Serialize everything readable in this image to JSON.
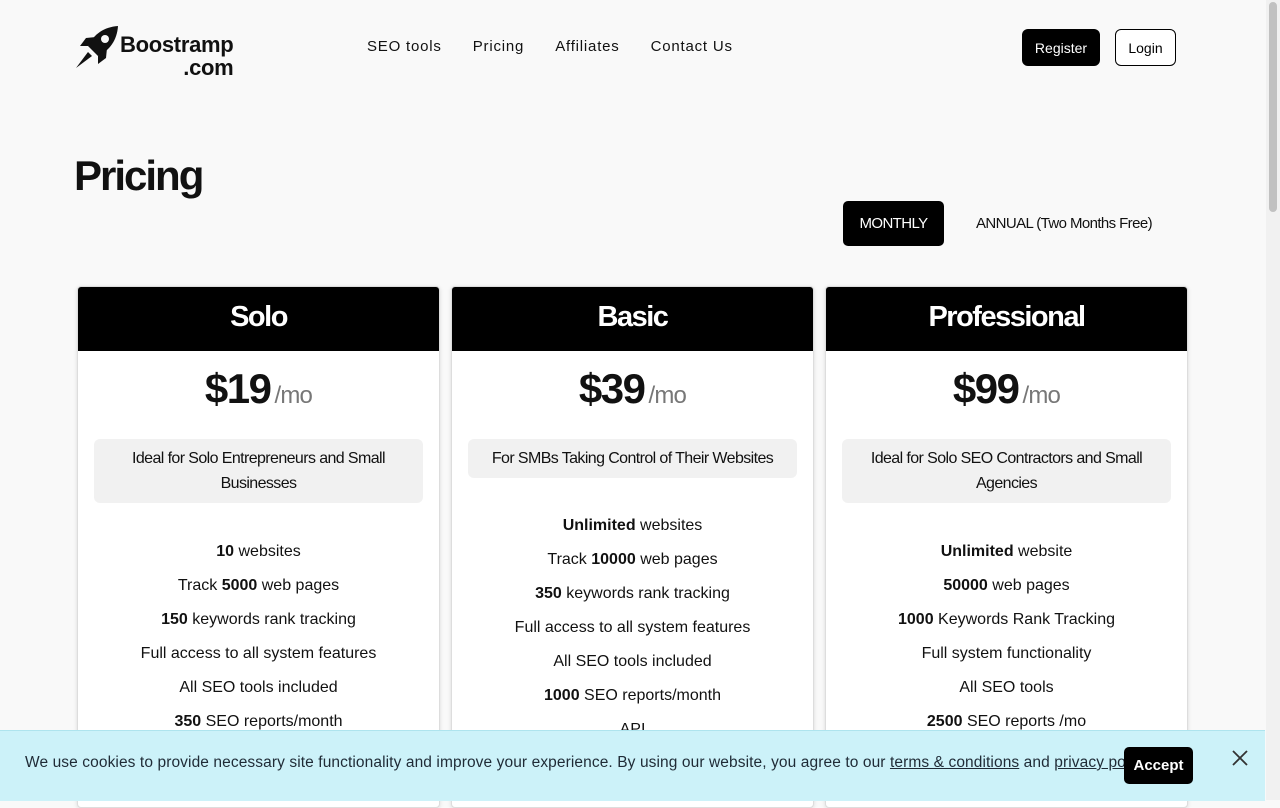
{
  "brand": {
    "line1": "Boostramp",
    "line2": ".com"
  },
  "nav": [
    "SEO tools",
    "Pricing",
    "Affiliates",
    "Contact Us"
  ],
  "auth": {
    "register": "Register",
    "login": "Login"
  },
  "page": {
    "title": "Pricing"
  },
  "billing": {
    "monthly": "MONTHLY",
    "annual": "ANNUAL (Two Months Free)"
  },
  "plans": [
    {
      "name": "Solo",
      "price": "$19",
      "per": "/mo",
      "description": "Ideal for Solo Entrepreneurs and Small Businesses",
      "features": [
        {
          "bold": "10",
          "text": " websites"
        },
        {
          "pre": "Track ",
          "bold": "5000",
          "text": " web pages"
        },
        {
          "bold": "150",
          "text": " keywords rank tracking"
        },
        {
          "text": "Full access to all system features"
        },
        {
          "text": "All SEO tools included"
        },
        {
          "bold": "350",
          "text": " SEO reports/month"
        }
      ]
    },
    {
      "name": "Basic",
      "price": "$39",
      "per": "/mo",
      "description": "For SMBs Taking Control of Their Websites",
      "features": [
        {
          "bold": "Unlimited",
          "text": " websites"
        },
        {
          "pre": "Track ",
          "bold": "10000",
          "text": " web pages"
        },
        {
          "bold": "350",
          "text": " keywords rank tracking"
        },
        {
          "text": "Full access to all system features"
        },
        {
          "text": "All SEO tools included"
        },
        {
          "bold": "1000",
          "text": " SEO reports/month"
        },
        {
          "text": "API"
        }
      ]
    },
    {
      "name": "Professional",
      "price": "$99",
      "per": "/mo",
      "description": "Ideal for Solo SEO Contractors and Small Agencies",
      "features": [
        {
          "bold": "Unlimited",
          "text": " website"
        },
        {
          "bold": "50000",
          "text": " web pages"
        },
        {
          "bold": "1000",
          "text": " Keywords Rank Tracking"
        },
        {
          "text": "Full system functionality"
        },
        {
          "text": "All SEO tools"
        },
        {
          "bold": "2500",
          "text": " SEO reports /mo"
        }
      ]
    }
  ],
  "cookie": {
    "text": "We use cookies to provide necessary site functionality and improve your experience. By using our website, you agree to our ",
    "terms": "terms & conditions",
    "and": " and ",
    "privacy": "privacy policy",
    "end": ".",
    "accept": "Accept"
  }
}
